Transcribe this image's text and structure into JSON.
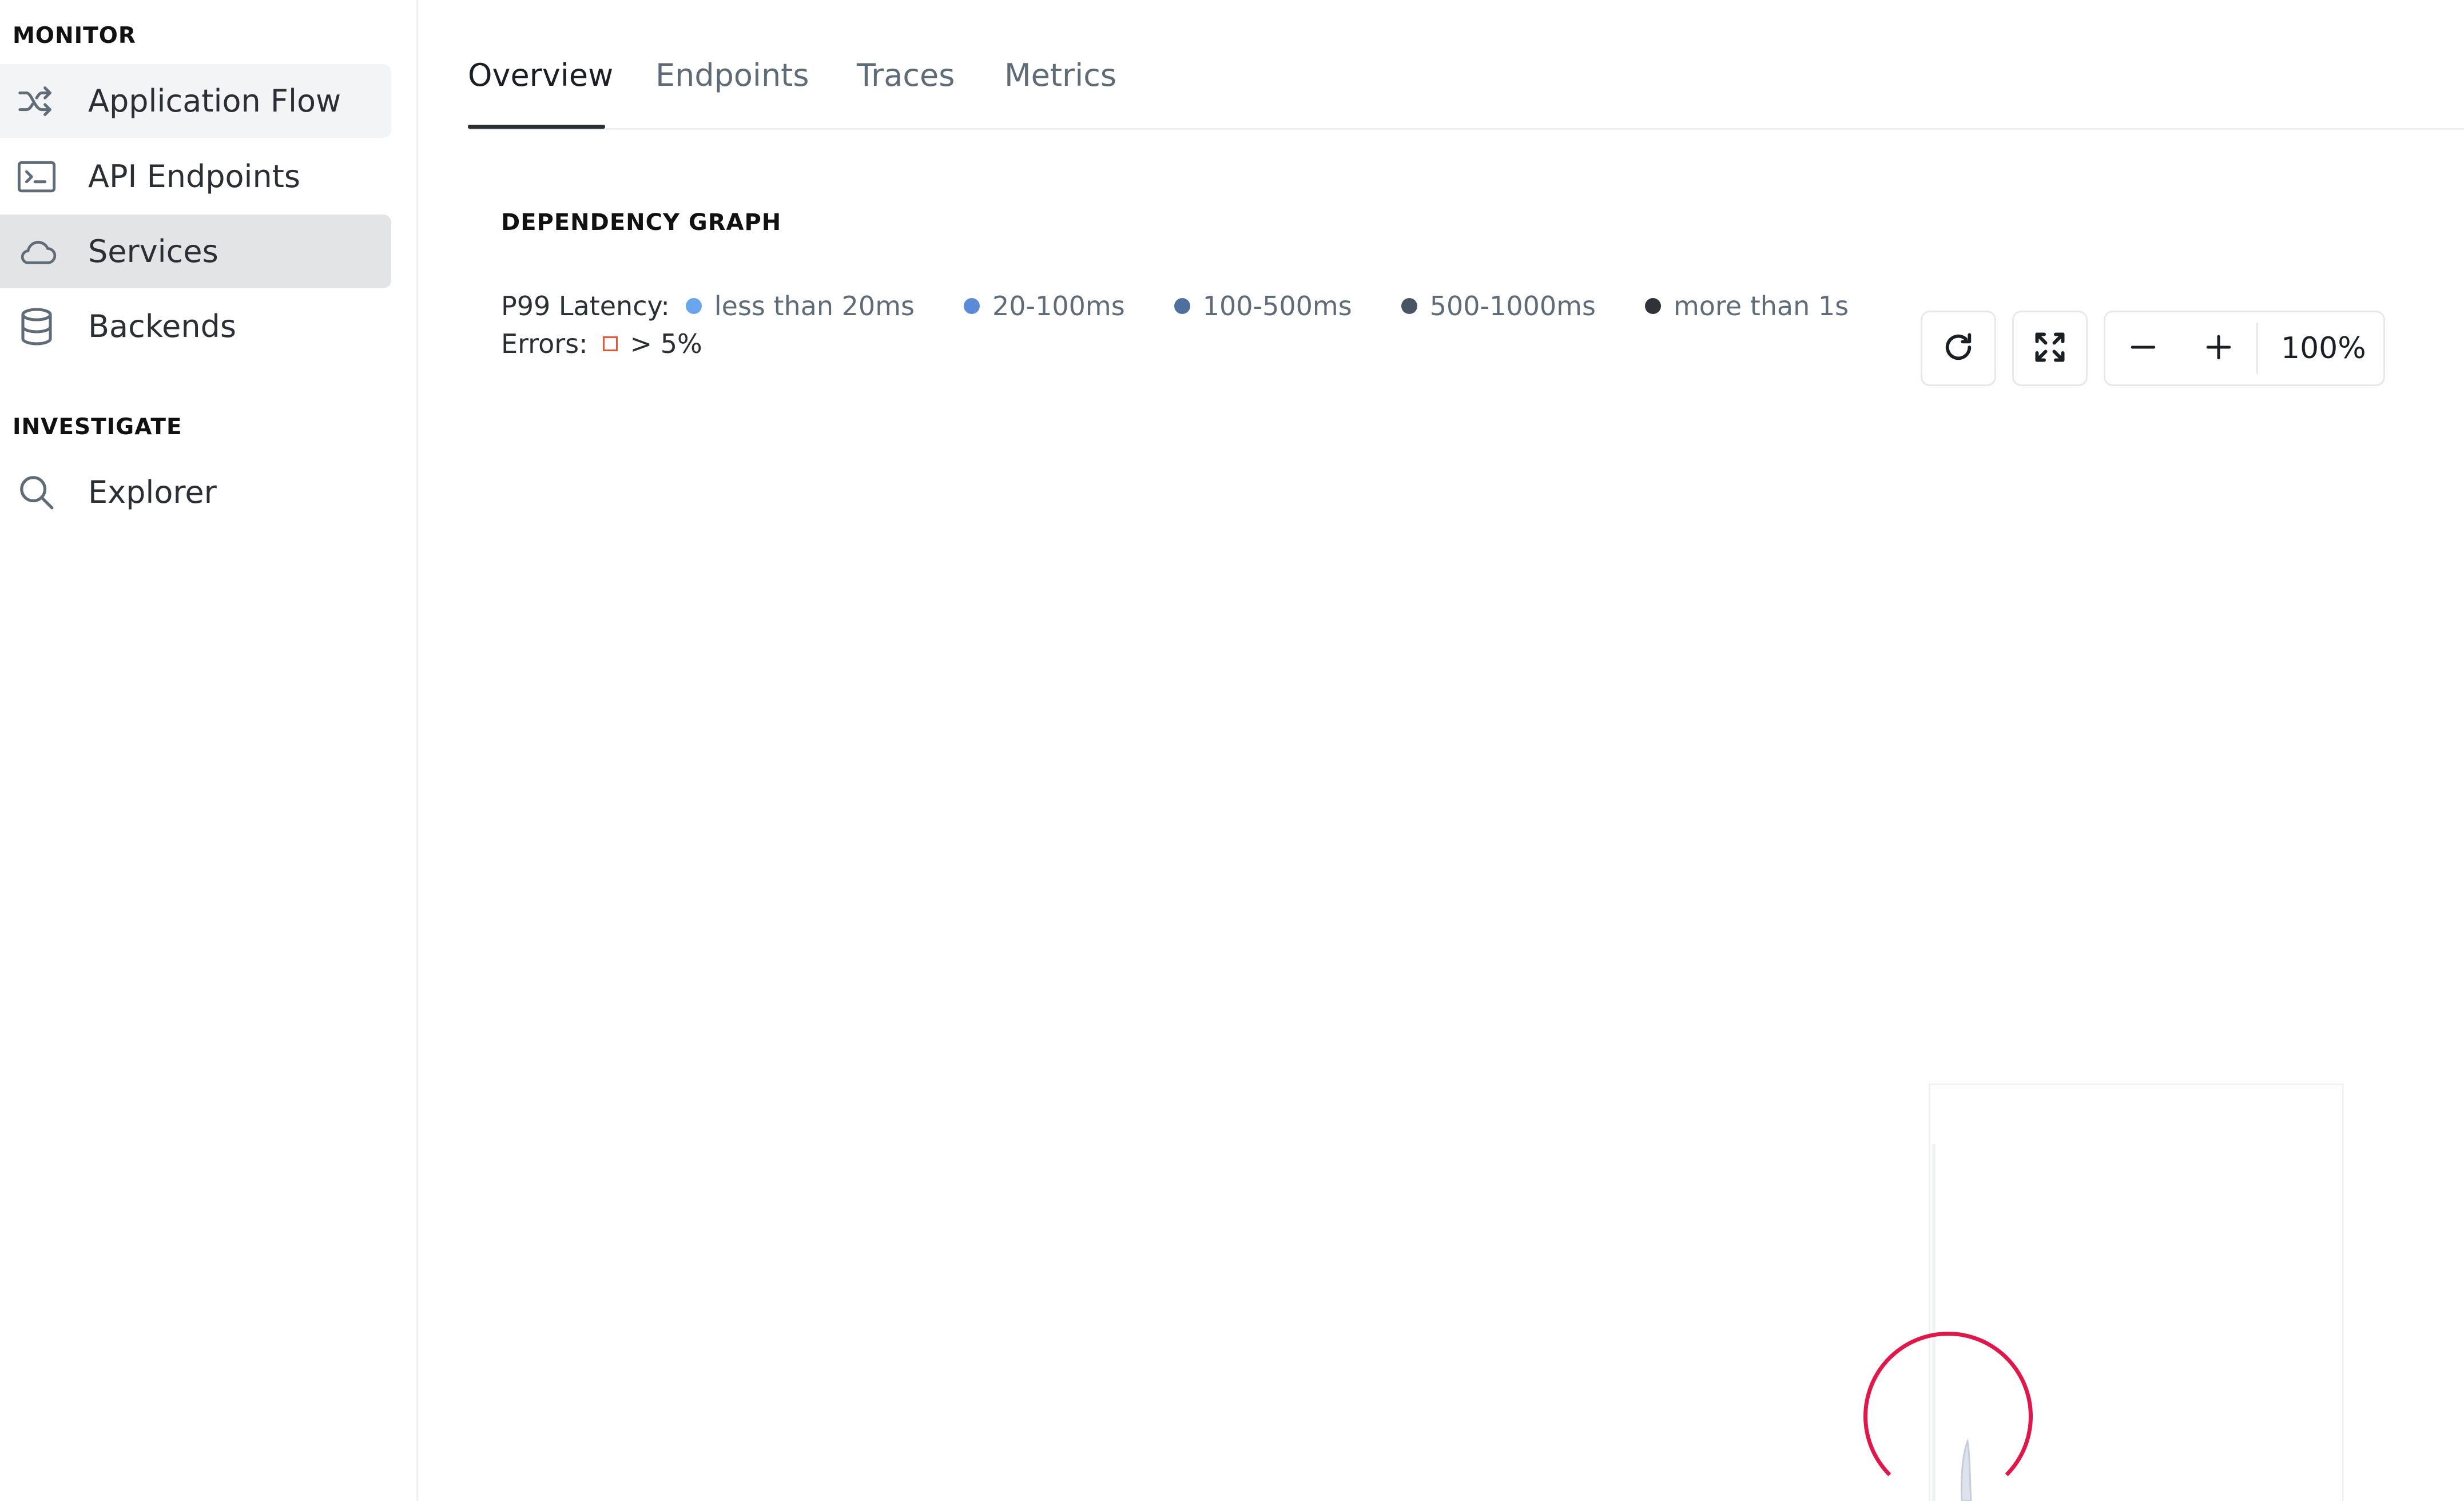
{
  "sidebar": {
    "monitor_title": "MONITOR",
    "monitor_items": [
      {
        "label": "Application Flow",
        "icon": "shuffle-icon",
        "state": "hover"
      },
      {
        "label": "API Endpoints",
        "icon": "terminal-icon",
        "state": "normal"
      },
      {
        "label": "Services",
        "icon": "cloud-icon",
        "state": "active"
      },
      {
        "label": "Backends",
        "icon": "database-icon",
        "state": "normal"
      }
    ],
    "investigate_title": "INVESTIGATE",
    "investigate_items": [
      {
        "label": "Explorer",
        "icon": "search-icon",
        "state": "normal"
      }
    ]
  },
  "tabs": [
    {
      "label": "Overview",
      "active": true
    },
    {
      "label": "Endpoints",
      "active": false
    },
    {
      "label": "Traces",
      "active": false
    },
    {
      "label": "Metrics",
      "active": false
    }
  ],
  "graph": {
    "title": "DEPENDENCY GRAPH",
    "latency_label": "P99 Latency:",
    "latency_legend": [
      {
        "label": "less than 20ms",
        "color": "#6aa6ee"
      },
      {
        "label": "20-100ms",
        "color": "#5b8bd6"
      },
      {
        "label": "100-500ms",
        "color": "#4f6f9e"
      },
      {
        "label": "500-1000ms",
        "color": "#4a5564"
      },
      {
        "label": "more than 1s",
        "color": "#2f3338"
      }
    ],
    "errors_label": "Errors:",
    "errors_value": "> 5%",
    "errors_color": "#e4573d"
  },
  "controls": {
    "refresh_icon": "refresh-icon",
    "fullscreen_icon": "expand-icon",
    "zoom_out_icon": "minus-icon",
    "zoom_in_icon": "plus-icon",
    "zoom_level": "100%"
  },
  "colors": {
    "highlight": "#e0174a",
    "active_nav": "#e2e4e6",
    "hover_nav": "#f3f4f5"
  }
}
